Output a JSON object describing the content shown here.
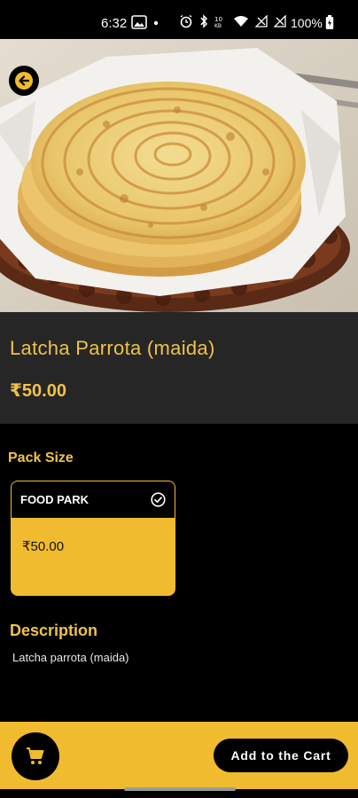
{
  "status_bar": {
    "time": "6:32",
    "battery": "100%",
    "icons": [
      "gallery-icon",
      "dot-icon",
      "alarm-icon",
      "bluetooth-icon",
      "data-speed-icon",
      "wifi-icon",
      "signal-icon",
      "signal-icon",
      "battery-icon"
    ]
  },
  "product": {
    "title": "Latcha Parrota (maida)",
    "price": "₹50.00"
  },
  "pack": {
    "label": "Pack Size",
    "option_name": "FOOD PARK",
    "option_price": "₹50.00",
    "selected": true
  },
  "description": {
    "title": "Description",
    "text": "Latcha parrota (maida)"
  },
  "actions": {
    "add_to_cart": "Add to the Cart"
  },
  "colors": {
    "accent": "#f0bb2e",
    "title_text": "#f0c24a",
    "panel": "#262626",
    "background": "#000000"
  }
}
